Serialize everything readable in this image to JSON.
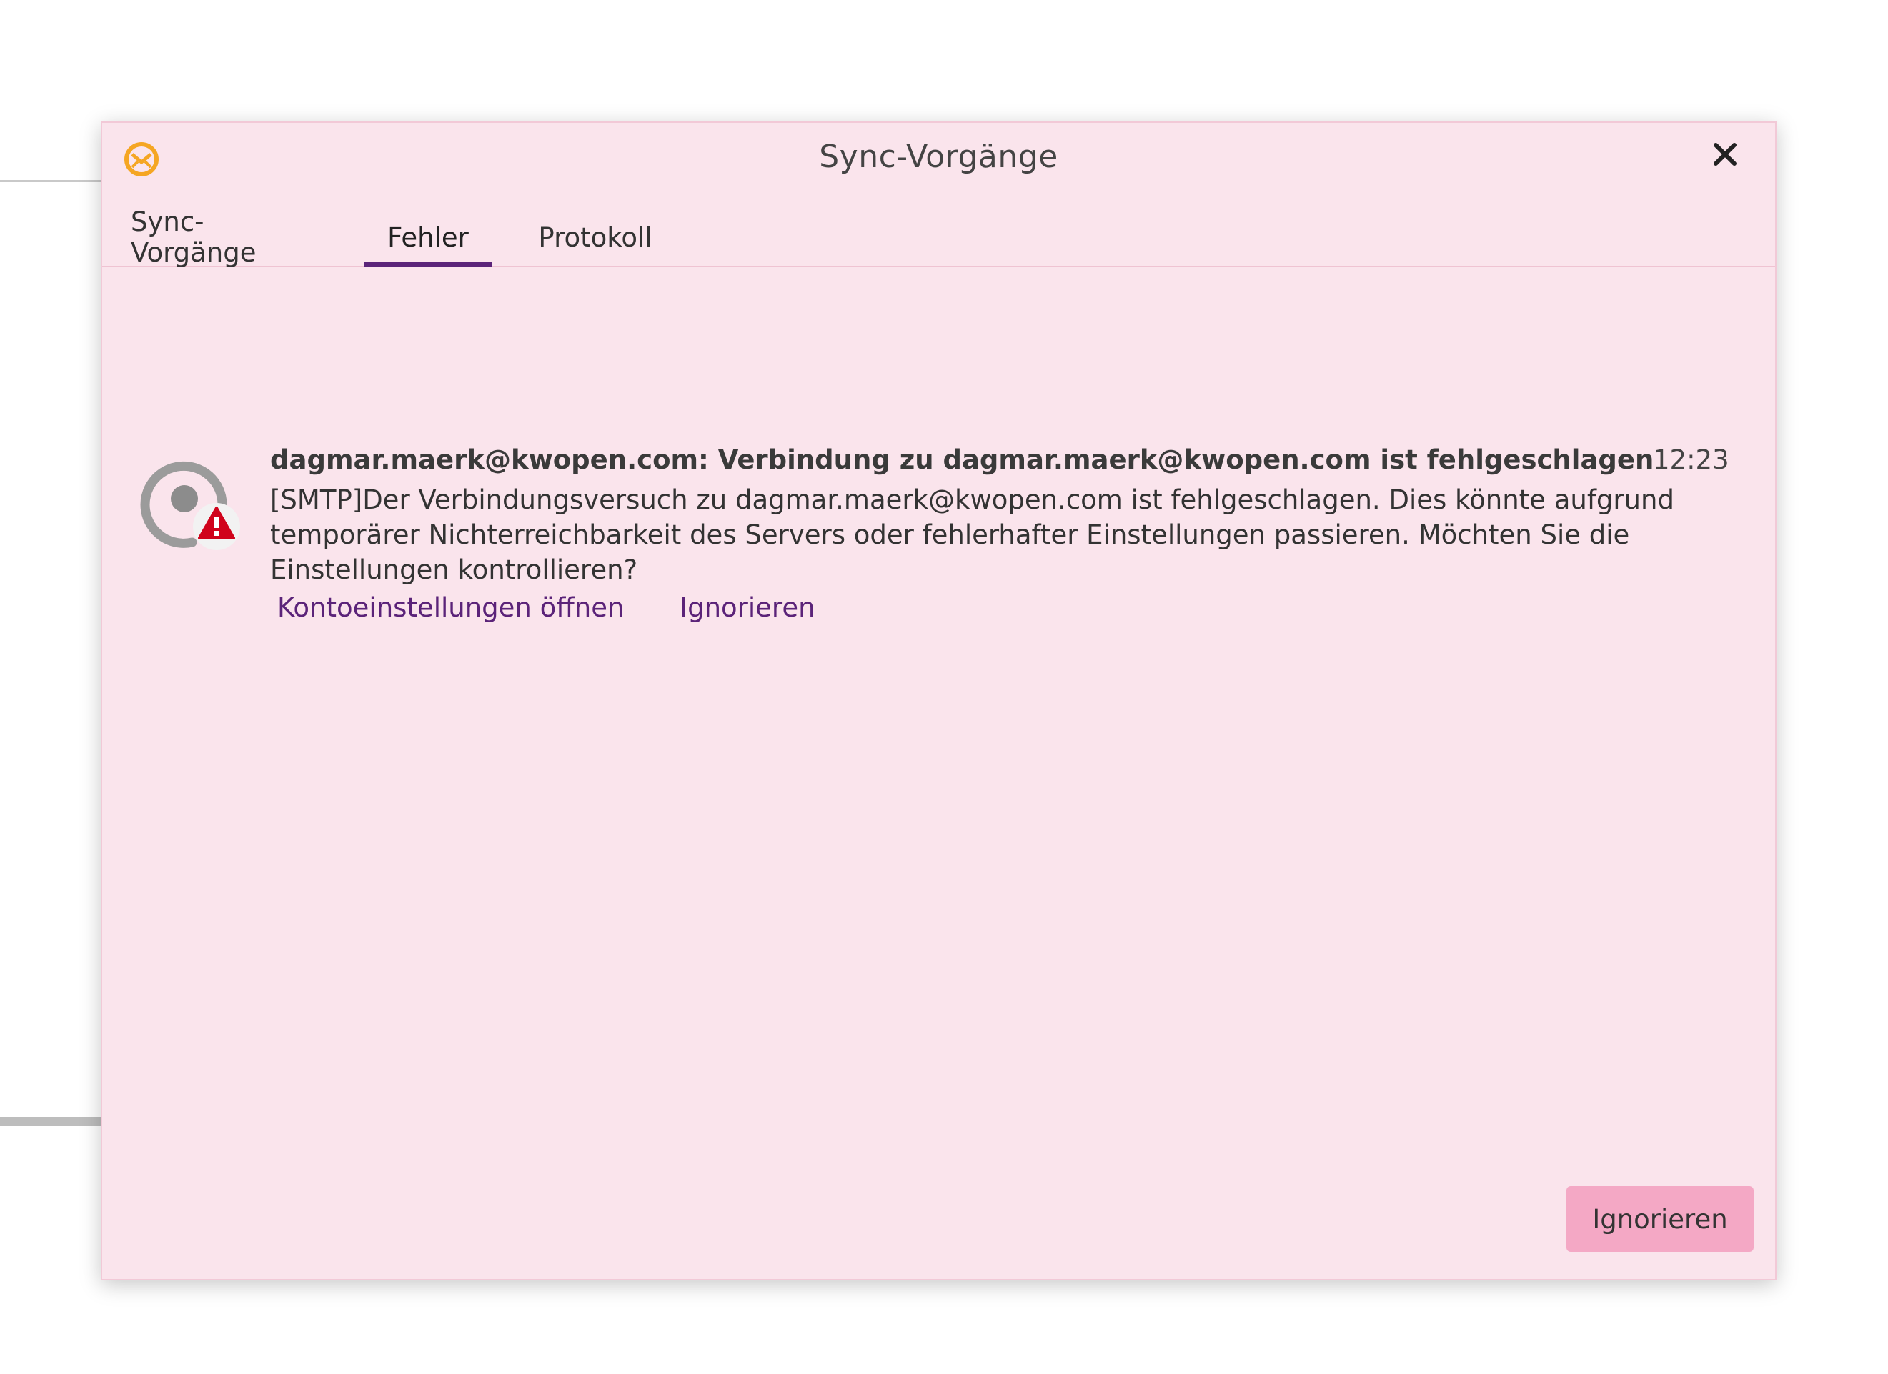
{
  "dialog": {
    "title": "Sync-Vorgänge",
    "close_icon": "close-icon",
    "app_icon": "emclient-logo-icon"
  },
  "tabs": [
    {
      "label": "Sync-Vorgänge",
      "active": false
    },
    {
      "label": "Fehler",
      "active": true
    },
    {
      "label": "Protokoll",
      "active": false
    }
  ],
  "error": {
    "icon": "sync-error-icon",
    "headline": "dagmar.maerk@kwopen.com: Verbindung zu dagmar.maerk@kwopen.com ist fehlgeschlagen",
    "time": "12:23",
    "body": "[SMTP]Der Verbindungsversuch zu dagmar.maerk@kwopen.com ist fehlgeschlagen. Dies könnte aufgrund temporärer Nichterreichbarkeit des Servers oder fehlerhafter Einstellungen passieren. Möchten Sie die Einstellungen kontrollieren?",
    "actions": {
      "open_settings": "Kontoeinstellungen öffnen",
      "ignore": "Ignorieren"
    }
  },
  "footer": {
    "ignore_button": "Ignorieren"
  },
  "colors": {
    "dialog_bg": "#fae4ec",
    "accent": "#5b2379",
    "button_bg": "#f4a8c5",
    "error_red": "#d0021b",
    "logo_orange": "#f5a623"
  }
}
